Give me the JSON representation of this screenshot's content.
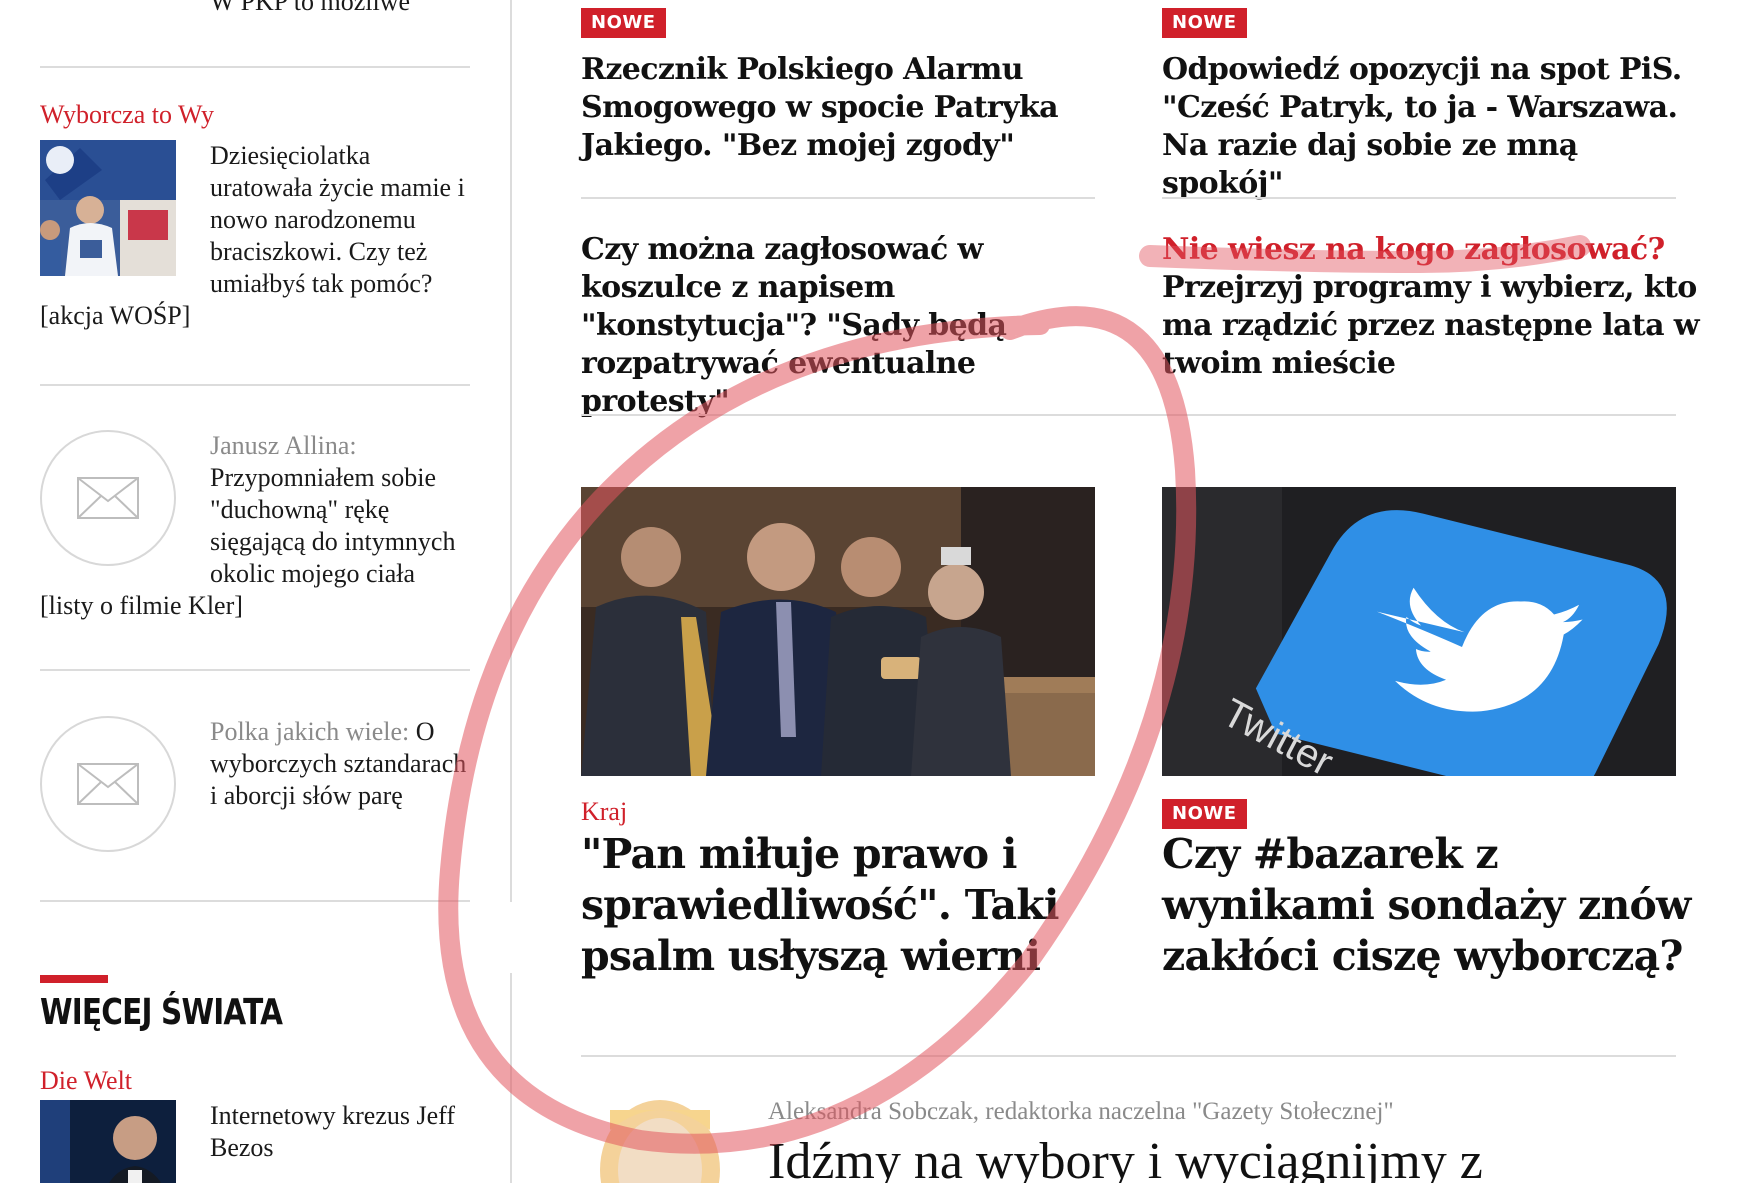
{
  "sidebar": {
    "top_fragment": "W PKP to możliwe",
    "item1": {
      "category": "Wyborcza to Wy",
      "text": "Dziesięciolatka uratowała życie mamie i nowo narodzonemu braciszkowi. Czy też umiałbyś tak pomóc? [akcja WOŚP]"
    },
    "item2": {
      "author": "Janusz Allina:",
      "text": "Przypomniałem sobie \"duchowną\" rękę sięgającą do intymnych okolic mojego ciała [listy o filmie Kler]"
    },
    "item3": {
      "author": "Polka jakich wiele:",
      "text": "O wyborczych sztandarach i aborcji słów parę"
    },
    "section_title": "WIĘCEJ ŚWIATA",
    "item4": {
      "category": "Die Welt",
      "text": "Internetowy krezus Jeff Bezos"
    }
  },
  "main": {
    "badge_label": "NOWE",
    "article1": "Rzecznik Polskiego Alarmu Smogowego w spocie Patryka Jakiego. \"Bez mojej zgody\"",
    "article2": "Odpowiedź opozycji na spot PiS. \"Cześć Patryk, to ja - Warszawa. Na razie daj sobie ze mną spokój\"",
    "article3": "Czy można zagłosować w koszulce z napisem \"konstytucja\"? \"Sądy będą rozpatrywać ewentualne protesty\"",
    "article4_highlight": "Nie wiesz na kogo zagłosować?",
    "article4_rest": "Przejrzyj programy i wybierz, kto ma rządzić przez następne lata w twoim mieście",
    "article5_category": "Kraj",
    "article5": "\"Pan miłuje prawo i sprawiedliwość\". Taki psalm usłyszą wierni",
    "article6": "Czy #bazarek z wynikami sondaży znów zakłóci ciszę wyborczą?",
    "twitter_text": "Twitter",
    "bottom_author": "Aleksandra Sobczak, redaktorka naczelna \"Gazety Stołecznej\"",
    "bottom_headline": "Idźmy na wybory i wyciągnijmy z"
  },
  "colors": {
    "accent_red": "#d0202a",
    "rule_grey": "#dcdcdc",
    "annotation_red": "#e2555f",
    "twitter_blue": "#2f8fe6"
  }
}
